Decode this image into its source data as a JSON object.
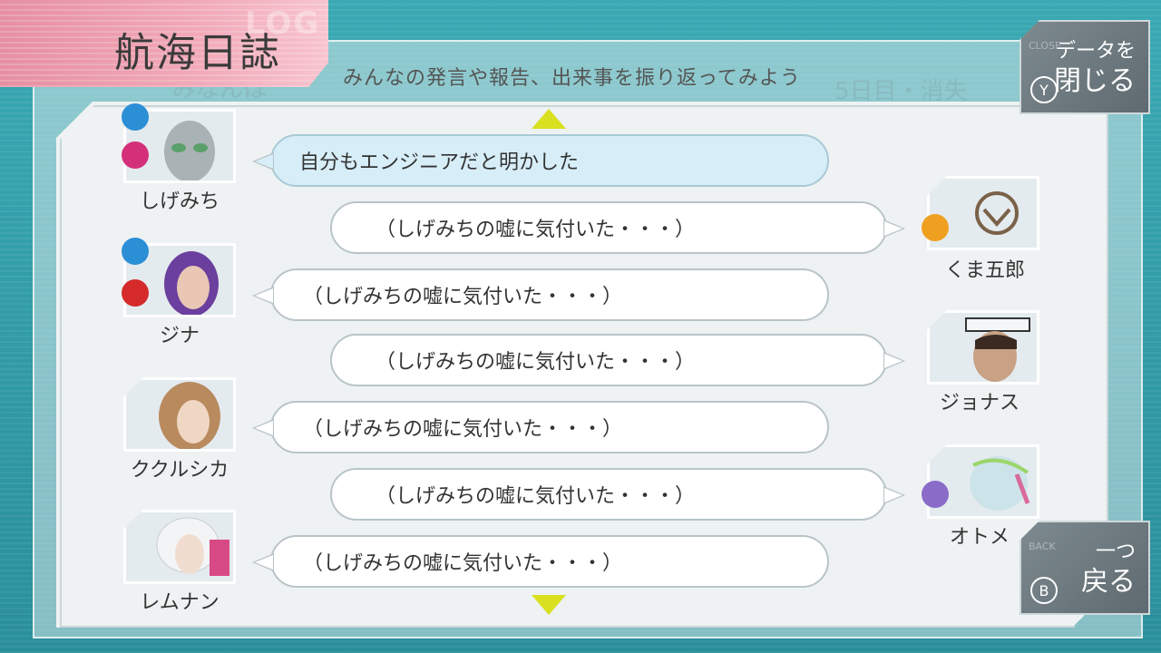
{
  "header": {
    "title": "航海日誌",
    "logo_ghost": "LOG",
    "subtitle": "みんなの発言や報告、出来事を振り返ってみよう"
  },
  "ghost_text": {
    "left": "みなんは",
    "right": "5日目・消失"
  },
  "buttons": {
    "close": {
      "line1": "データを",
      "line2": "閉じる",
      "key": "Y",
      "ghost": "CLOSE"
    },
    "back": {
      "line1": "一つ",
      "line2": "戻る",
      "key": "B",
      "ghost": "BACK"
    }
  },
  "characters": {
    "shigemichi": "しげみち",
    "kumagoro": "くま五郎",
    "gina": "ジナ",
    "jonas": "ジョナス",
    "kukurushika": "ククルシカ",
    "otome": "オトメ",
    "remnan": "レムナン"
  },
  "entries": [
    {
      "speaker": "しげみち",
      "text": "自分もエンジニアだと明かした",
      "highlighted": true
    },
    {
      "speaker": "くま五郎",
      "text": "（しげみちの嘘に気付いた・・・）"
    },
    {
      "speaker": "ジナ",
      "text": "（しげみちの嘘に気付いた・・・）"
    },
    {
      "speaker": "ジョナス",
      "text": "（しげみちの嘘に気付いた・・・）"
    },
    {
      "speaker": "ククルシカ",
      "text": "（しげみちの嘘に気付いた・・・）"
    },
    {
      "speaker": "オトメ",
      "text": "（しげみちの嘘に気付いた・・・）"
    },
    {
      "speaker": "レムナン",
      "text": "（しげみちの嘘に気付いた・・・）"
    }
  ],
  "colors": {
    "accent_pink": "#e68fa2",
    "bubble_highlight": "#d7eef8",
    "arrow": "#d8e020",
    "engineer_icon": "#2b8fd6",
    "guardian_icon": "#d4307a",
    "doctor_icon": "#8a6cc8",
    "kumagoro_icon": "#f0a020"
  }
}
